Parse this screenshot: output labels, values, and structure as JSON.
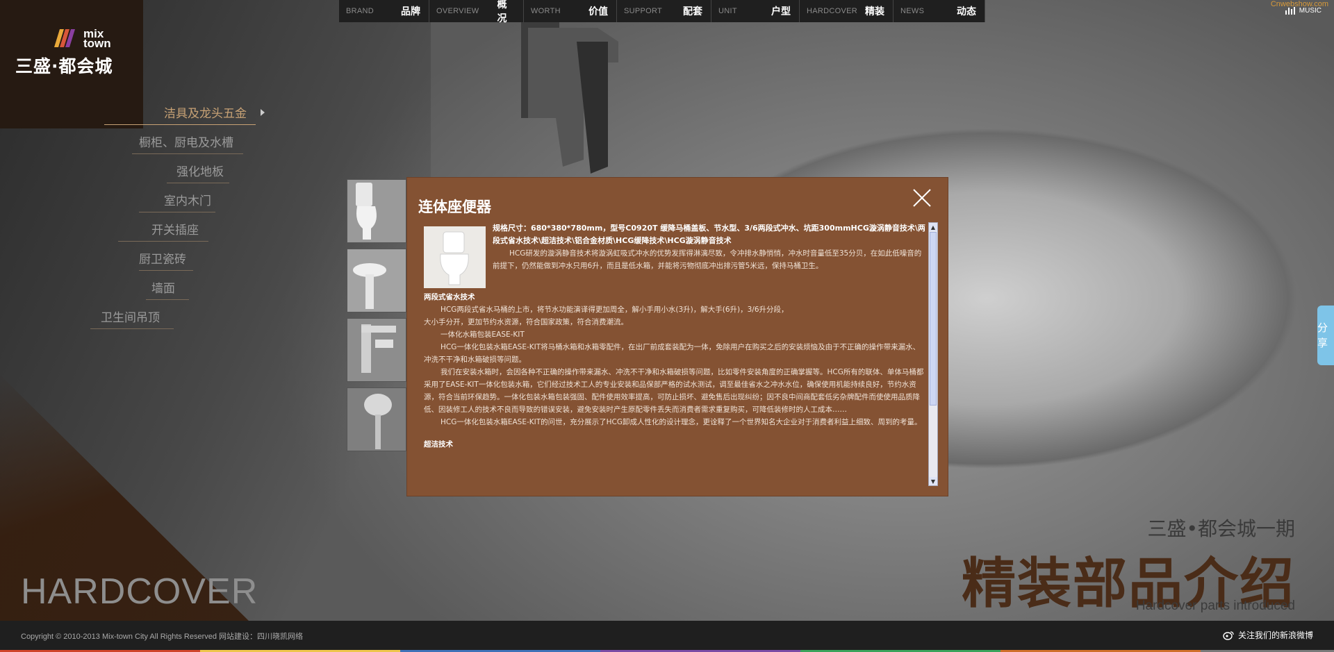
{
  "brand": {
    "logo_en_line1": "mix",
    "logo_en_line2": "town",
    "logo_cn": "三盛·都会城",
    "corner_link": "Cnwebshow.com",
    "music_label": "MUSIC"
  },
  "nav": [
    {
      "en": "BRAND",
      "cn": "品牌"
    },
    {
      "en": "OVERVIEW",
      "cn": "概况"
    },
    {
      "en": "WORTH",
      "cn": "价值"
    },
    {
      "en": "SUPPORT",
      "cn": "配套"
    },
    {
      "en": "UNIT",
      "cn": "户型"
    },
    {
      "en": "HARDCOVER",
      "cn": "精装"
    },
    {
      "en": "NEWS",
      "cn": "动态"
    }
  ],
  "left_menu": [
    {
      "label": "洁具及龙头五金"
    },
    {
      "label": "橱柜、厨电及水槽"
    },
    {
      "label": "强化地板"
    },
    {
      "label": "室内木门"
    },
    {
      "label": "开关插座"
    },
    {
      "label": "厨卫瓷砖"
    },
    {
      "label": "墙面"
    },
    {
      "label": "卫生间吊顶"
    }
  ],
  "modal": {
    "title": "连体座便器",
    "spec": "规格尺寸：680*380*780mm，型号C0920T 缓降马桶盖板、节水型、3/6两段式冲水、坑距300mmHCG漩涡静音技术\\两段式省水技术\\超洁技术\\铝合金材质\\HCG缓降技术\\HCG漩涡静音技术",
    "p1": "HCG研发的漩涡静音技术将漩涡虹吸式冲水的优势发挥得淋漓尽致，令冲排水静悄悄，冲水时音量低至35分贝，在如此低噪音的前提下，仍然能做到冲水只用6升，而且是低水箱，并能将污物彻底冲出排污管5米远，保持马桶卫生。",
    "h2": "两段式省水技术",
    "p2": "HCG两段式省水马桶的上市，将节水功能演译得更加周全，解小手用小水(3升)，解大手(6升)，3/6升分段，",
    "p2b": "大小手分开，更加节约水资源，符合国家政策，符合消费潮流。",
    "p3": "一体化水箱包装EASE-KIT",
    "p4": "HCG一体化包装水箱EASE-KIT将马桶水箱和水箱零配件，在出厂前成套装配为一体，免除用户在购买之后的安装烦恼及由于不正确的操作带来漏水、冲洗不干净和水箱破损等问题。",
    "p5": "我们在安装水箱时，会因各种不正确的操作带来漏水、冲洗不干净和水箱破损等问题，比如零件安装角度的正确掌握等。HCG所有的联体、单体马桶都采用了EASE-KIT一体化包装水箱，它们经过技术工人的专业安装和品保部严格的试水测试，调至最佳省水之冲水水位，确保使用机能持续良好，节约水资源，符合当前环保趋势。一体化包装水箱包装强固、配件使用效率提高，可防止损坏、避免售后出现纠纷；因不良中间商配套低劣杂牌配件而使使用品质降低、因装修工人的技术不良而导致的错误安装，避免安装时产生原配零件丢失而消费者需求重复购买，可降低装修时的人工成本……",
    "p6": "HCG一体化包装水箱EASE-KIT的问世，充分展示了HCG卸成人性化的设计理念，更诠释了一个世界知名大企业对于消费者利益上细致、周到的考量。",
    "h3": "超洁技术"
  },
  "share": {
    "label": "分享"
  },
  "showcase": {
    "subtitle": "三盛•都会城一期",
    "title": "精装部品介绍",
    "en": "Hardcover parts introduced",
    "watermark": "HARDCOVER"
  },
  "footer": {
    "copyright": "Copyright © 2010-2013 Mix-town City All Rights Reserved 网站建设：四川晓凯网络",
    "weibo": "关注我们的新浪微博"
  }
}
